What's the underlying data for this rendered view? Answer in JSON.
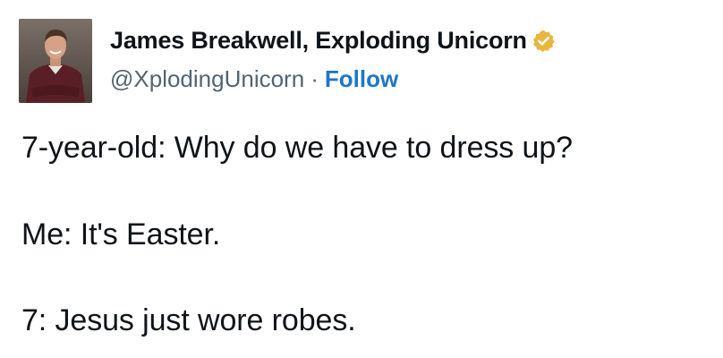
{
  "author": {
    "display_name": "James Breakwell, Exploding Unicorn",
    "handle": "@XplodingUnicorn",
    "separator": "·",
    "follow_label": "Follow",
    "verified_badge_icon": "verified-badge-gold",
    "avatar_icon": "profile-photo"
  },
  "tweet": {
    "lines": [
      "7-year-old: Why do we have to dress up?",
      "Me: It's Easter.",
      "7: Jesus just wore robes."
    ]
  },
  "colors": {
    "follow_link": "#1d76c9",
    "handle_text": "#536471",
    "verified_badge": "#e9b640"
  }
}
